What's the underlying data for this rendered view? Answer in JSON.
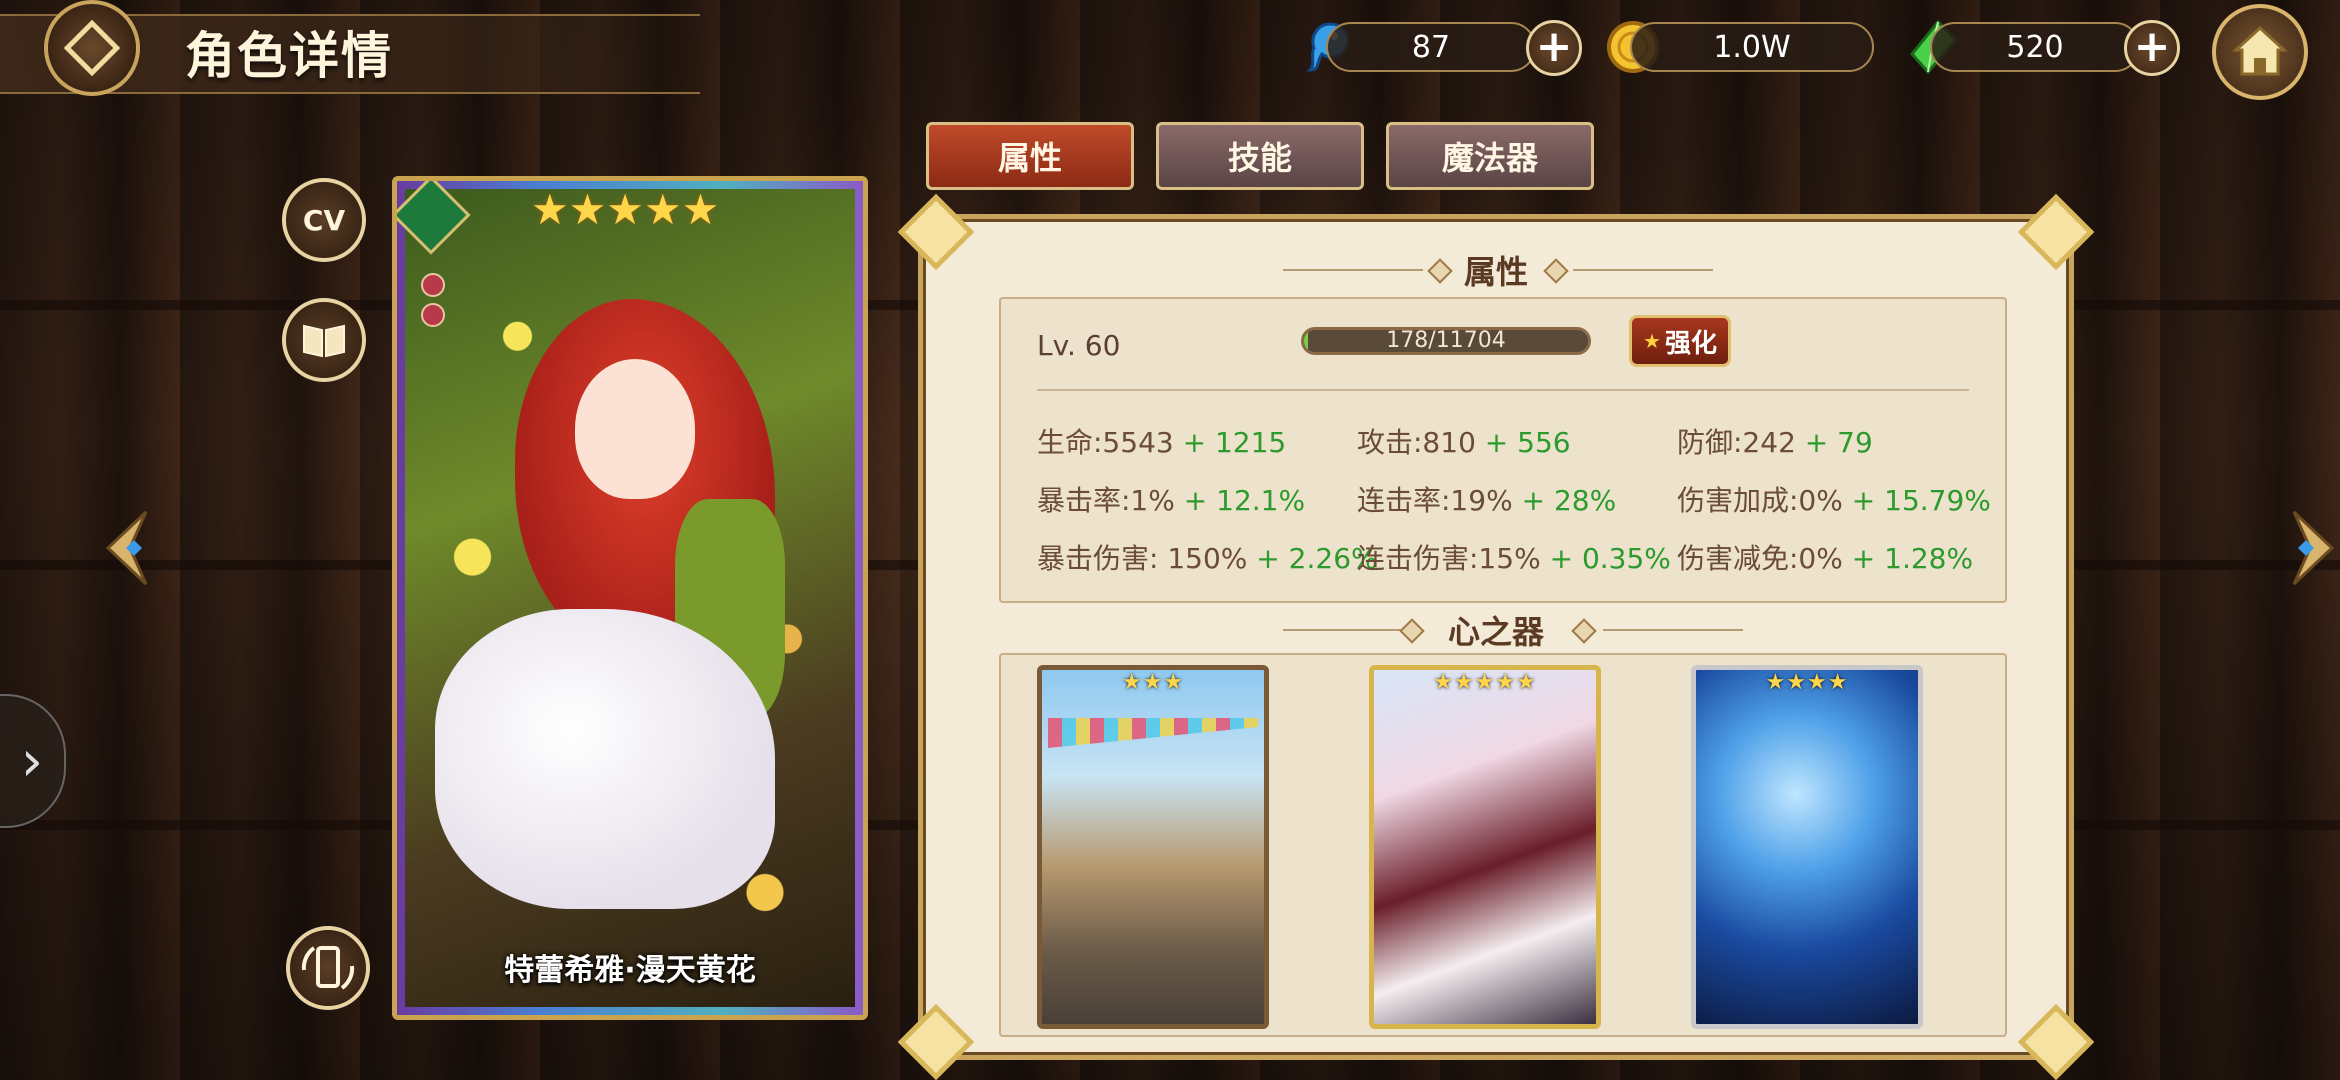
{
  "header": {
    "title": "角色详情"
  },
  "resources": [
    {
      "icon": "blue-spirit-icon",
      "value": "87"
    },
    {
      "icon": "gold-coin-icon",
      "value": "1.0W"
    },
    {
      "icon": "green-crystal-icon",
      "value": "520"
    }
  ],
  "side_buttons": {
    "cv_label": "CV"
  },
  "character_card": {
    "name": "特蕾希雅·漫天黄花",
    "stars": "★★★★★",
    "element_icon": "wind-element-icon"
  },
  "tabs": [
    {
      "label": "属性",
      "active": true
    },
    {
      "label": "技能",
      "active": false
    },
    {
      "label": "魔法器",
      "active": false
    }
  ],
  "attributes": {
    "section_title": "属性",
    "level": "Lv. 60",
    "exp_text": "178/11704",
    "exp_fraction": 0.0152,
    "upgrade_label": "强化",
    "stats": [
      {
        "label": "生命:5543",
        "bonus": "+ 1215"
      },
      {
        "label": "攻击:810",
        "bonus": "+ 556"
      },
      {
        "label": "防御:242",
        "bonus": "+ 79"
      },
      {
        "label": "暴击率:1%",
        "bonus": "+ 12.1%"
      },
      {
        "label": "连击率:19%",
        "bonus": "+ 28%"
      },
      {
        "label": "伤害加成:0%",
        "bonus": "+ 15.79%"
      },
      {
        "label": "暴击伤害: 150%",
        "bonus": "+ 2.26%"
      },
      {
        "label": "连击伤害:15%",
        "bonus": "+ 0.35%"
      },
      {
        "label": "伤害减免:0%",
        "bonus": "+ 1.28%"
      }
    ]
  },
  "heart_artifacts": {
    "section_title": "心之器",
    "items": [
      {
        "stars": "★★★"
      },
      {
        "stars": "★★★★★"
      },
      {
        "stars": "★★★★"
      }
    ]
  },
  "colors": {
    "accent": "#c9a45c",
    "bonus_green": "#2c9a2c",
    "active_tab": "#b0401f"
  }
}
